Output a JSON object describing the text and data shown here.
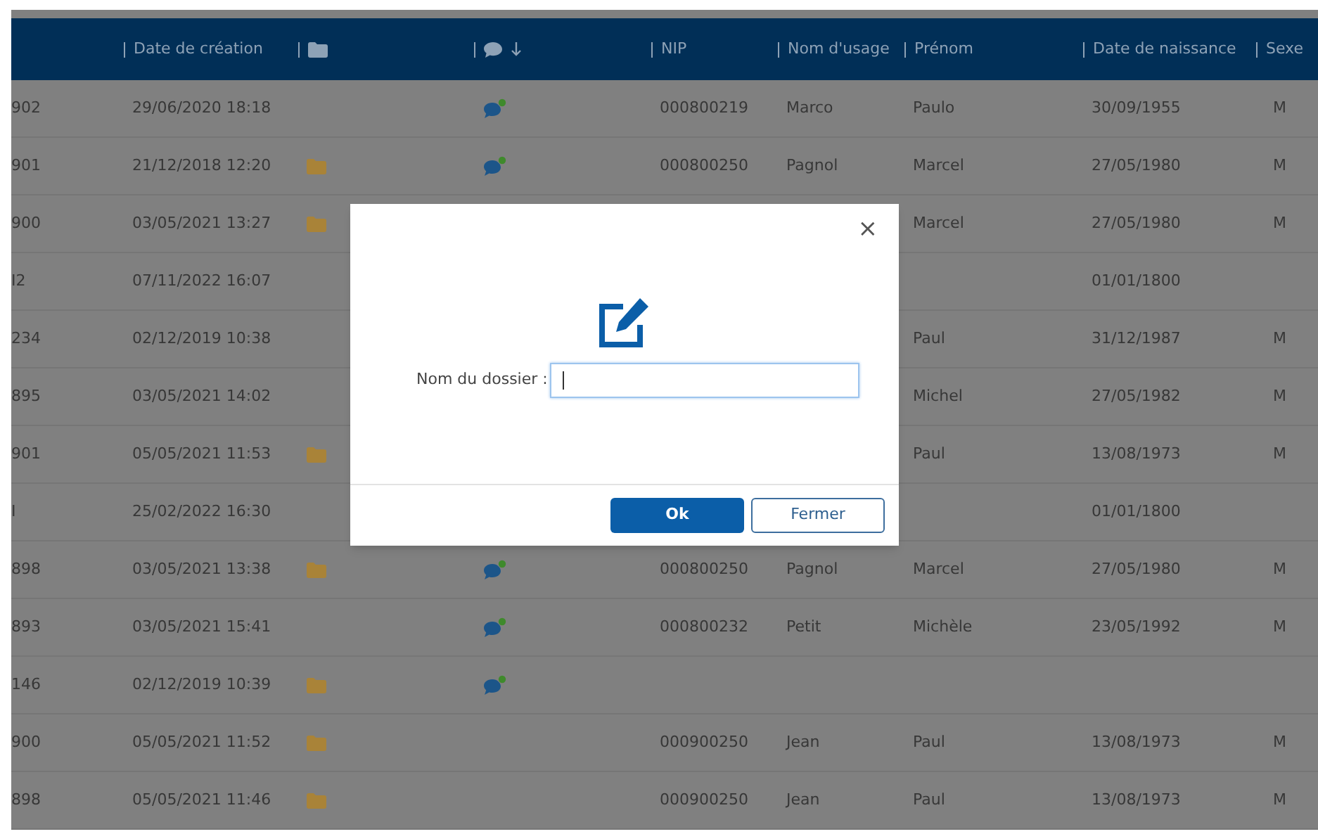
{
  "table": {
    "columns": [
      {
        "kind": "blank",
        "sorted": false
      },
      {
        "kind": "text",
        "label": "Date de création",
        "sorted": false
      },
      {
        "kind": "folder",
        "sorted": false
      },
      {
        "kind": "comment",
        "sorted": true
      },
      {
        "kind": "text",
        "label": "NIP",
        "sorted": false
      },
      {
        "kind": "text",
        "label": "Nom d'usage",
        "sorted": false
      },
      {
        "kind": "text",
        "label": "Prénom",
        "sorted": false
      },
      {
        "kind": "text",
        "label": "Date de naissance",
        "sorted": false
      },
      {
        "kind": "text",
        "label": "Sexe",
        "sorted": false
      }
    ],
    "rows": [
      {
        "id": "902",
        "created": "29/06/2020 18:18",
        "folder": false,
        "comment": true,
        "nip": "000800219",
        "nom": "Marco",
        "prenom": "Paulo",
        "naissance": "30/09/1955",
        "sexe": "M"
      },
      {
        "id": "901",
        "created": "21/12/2018 12:20",
        "folder": true,
        "comment": true,
        "nip": "000800250",
        "nom": "Pagnol",
        "prenom": "Marcel",
        "naissance": "27/05/1980",
        "sexe": "M"
      },
      {
        "id": "900",
        "created": "03/05/2021 13:27",
        "folder": true,
        "comment": false,
        "prenom": "Marcel",
        "naissance": "27/05/1980",
        "sexe": "M"
      },
      {
        "id": "I2",
        "created": "07/11/2022 16:07",
        "folder": false,
        "comment": false,
        "naissance": "01/01/1800"
      },
      {
        "id": "234",
        "created": "02/12/2019 10:38",
        "folder": false,
        "comment": false,
        "prenom": "Paul",
        "naissance": "31/12/1987",
        "sexe": "M"
      },
      {
        "id": "895",
        "created": "03/05/2021 14:02",
        "folder": false,
        "comment": false,
        "prenom": "Michel",
        "naissance": "27/05/1982",
        "sexe": "M"
      },
      {
        "id": "901",
        "created": "05/05/2021 11:53",
        "folder": true,
        "comment": false,
        "prenom": "Paul",
        "naissance": "13/08/1973",
        "sexe": "M"
      },
      {
        "id": "I",
        "created": "25/02/2022 16:30",
        "folder": false,
        "comment": false,
        "naissance": "01/01/1800"
      },
      {
        "id": "898",
        "created": "03/05/2021 13:38",
        "folder": true,
        "comment": true,
        "nip": "000800250",
        "nom": "Pagnol",
        "prenom": "Marcel",
        "naissance": "27/05/1980",
        "sexe": "M"
      },
      {
        "id": "893",
        "created": "03/05/2021 15:41",
        "folder": false,
        "comment": true,
        "nip": "000800232",
        "nom": "Petit",
        "prenom": "Michèle",
        "naissance": "23/05/1992",
        "sexe": "M"
      },
      {
        "id": "146",
        "created": "02/12/2019 10:39",
        "folder": true,
        "comment": true
      },
      {
        "id": "900",
        "created": "05/05/2021 11:52",
        "folder": true,
        "comment": false,
        "nip": "000900250",
        "nom": "Jean",
        "prenom": "Paul",
        "naissance": "13/08/1973",
        "sexe": "M"
      },
      {
        "id": "898",
        "created": "05/05/2021 11:46",
        "folder": true,
        "comment": false,
        "nip": "000900250",
        "nom": "Jean",
        "prenom": "Paul",
        "naissance": "13/08/1973",
        "sexe": "M"
      }
    ]
  },
  "modal": {
    "close": "×",
    "field": {
      "label": "Nom du dossier :",
      "focused": true
    },
    "buttons": [
      {
        "label": "Ok",
        "kind": "primary"
      },
      {
        "label": "Fermer",
        "kind": "secondary"
      }
    ]
  }
}
